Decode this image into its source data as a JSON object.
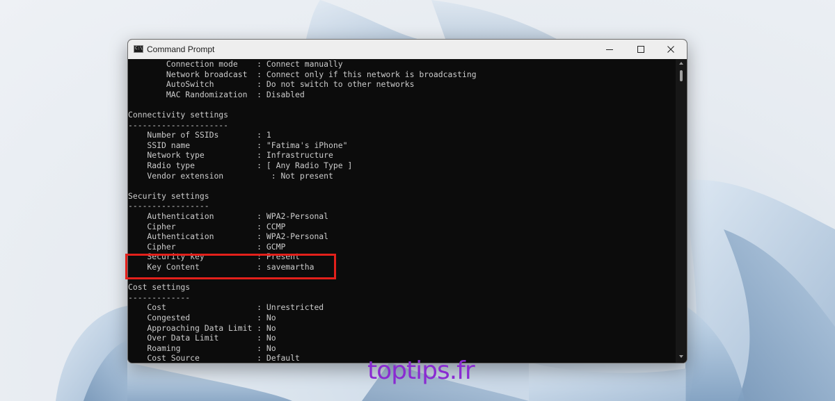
{
  "window": {
    "title": "Command Prompt",
    "icon_text": "C:\\"
  },
  "console": {
    "lines": [
      "        Connection mode    : Connect manually",
      "        Network broadcast  : Connect only if this network is broadcasting",
      "        AutoSwitch         : Do not switch to other networks",
      "        MAC Randomization  : Disabled",
      "",
      "Connectivity settings",
      "---------------------",
      "    Number of SSIDs        : 1",
      "    SSID name              : \"Fatima's iPhone\"",
      "    Network type           : Infrastructure",
      "    Radio type             : [ Any Radio Type ]",
      "    Vendor extension          : Not present",
      "",
      "Security settings",
      "-----------------",
      "    Authentication         : WPA2-Personal",
      "    Cipher                 : CCMP",
      "    Authentication         : WPA2-Personal",
      "    Cipher                 : GCMP",
      "    Security key           : Present",
      "    Key Content            : savemartha",
      "",
      "Cost settings",
      "-------------",
      "    Cost                   : Unrestricted",
      "    Congested              : No",
      "    Approaching Data Limit : No",
      "    Over Data Limit        : No",
      "    Roaming                : No",
      "    Cost Source            : Default"
    ]
  },
  "colors": {
    "console_bg": "#0c0c0c",
    "console_text": "#cccccc",
    "highlight_border": "#e3201b",
    "watermark": "#8a2bd1"
  },
  "watermark": {
    "text": "toptips.fr"
  }
}
